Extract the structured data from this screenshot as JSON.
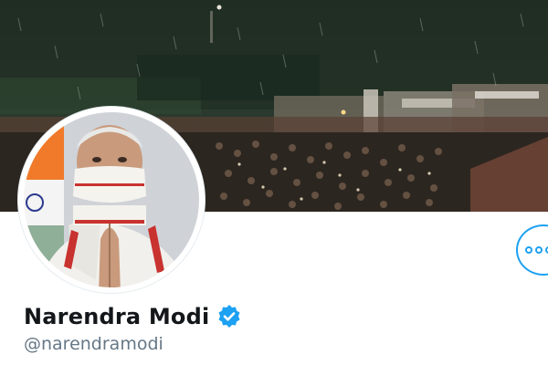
{
  "profile": {
    "display_name": "Narendra Modi",
    "handle": "@narendramodi",
    "verified": true
  },
  "banner": {
    "image": "night-crowd-photo"
  },
  "avatar": {
    "image": "profile-photo-folded-hands"
  },
  "actions": {
    "more_icon": "more-options-icon"
  },
  "colors": {
    "accent": "#1da1f2",
    "name": "#14171a",
    "handle": "#657786"
  }
}
